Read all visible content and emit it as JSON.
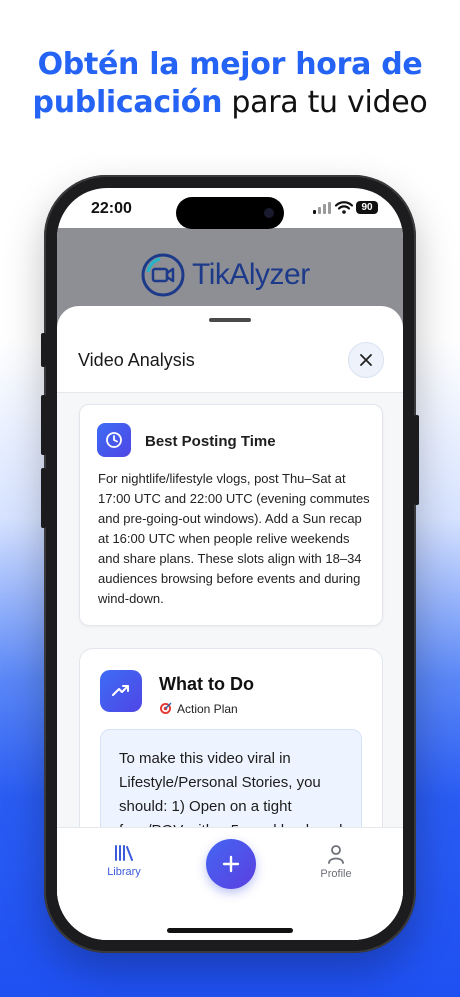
{
  "headline": {
    "line1": "Obtén la mejor hora de",
    "line2_highlight": "publicación",
    "line2_rest": " para tu video"
  },
  "status_bar": {
    "time": "22:00",
    "battery": "90"
  },
  "app": {
    "logo_text": "TikAlyzer"
  },
  "sheet": {
    "title": "Video Analysis",
    "close_icon": "close-icon"
  },
  "best_time_card": {
    "icon": "clock-icon",
    "title": "Best Posting Time",
    "body": "For nightlife/lifestyle vlogs, post Thu–Sat at 17:00 UTC and 22:00 UTC (evening commutes and pre-going-out windows). Add a Sun recap at 16:00 UTC when people relive weekends and share plans. These slots align with 18–34 audiences browsing before events and during wind-down."
  },
  "what_to_do_card": {
    "icon": "trending-up-icon",
    "title": "What to Do",
    "subtitle_icon": "target-icon",
    "subtitle": "Action Plan",
    "plan_text": "To make this video viral in Lifestyle/Personal Stories, you should: 1) Open on a tight face/POV with a 5-word hook and"
  },
  "tabbar": {
    "library_label": "Library",
    "profile_label": "Profile",
    "add_icon": "plus-icon"
  },
  "colors": {
    "accent": "#2563f5",
    "button_gradient_start": "#4466f2",
    "button_gradient_end": "#5b3fe0",
    "active_tab": "#3b5bdb"
  }
}
